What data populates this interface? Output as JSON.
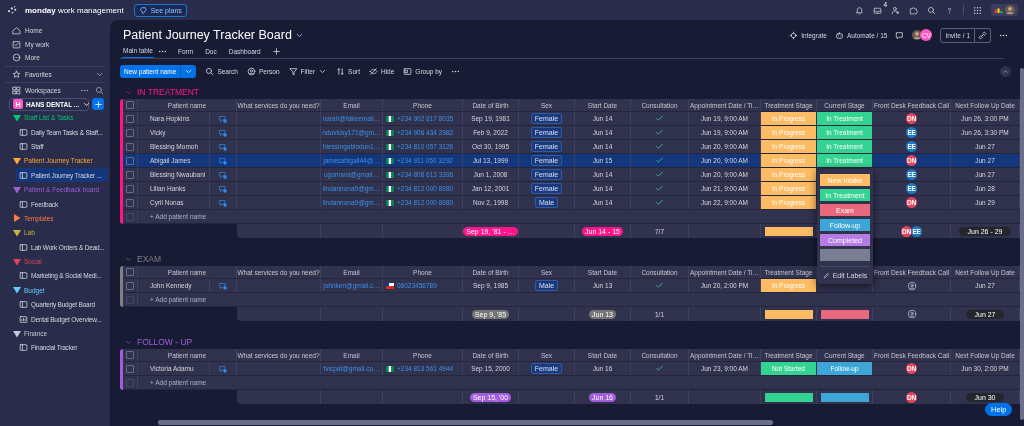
{
  "top_bar": {
    "brand": "**monday** work management",
    "upgrade": "See plans",
    "inbox_count": "4"
  },
  "sidebar": {
    "nav": [
      {
        "label": "Home",
        "kind": "home"
      },
      {
        "label": "My work",
        "kind": "mywork"
      },
      {
        "label": "More",
        "kind": "more"
      }
    ],
    "favorites": "Favorites",
    "workspaces": "Workspaces",
    "workspace": {
      "initial": "H",
      "name": "HANS DENTAL ..."
    },
    "folders": [
      {
        "label": "Staff List & Tasks",
        "color": "#00c875",
        "expanded": true,
        "children": [
          {
            "label": "Daily Team Tasks & Staff...",
            "kind": "board",
            "selected": false
          },
          {
            "label": "Staff",
            "kind": "board",
            "selected": false
          }
        ]
      },
      {
        "label": "Patient Journey Tracker",
        "color": "#fdab3d",
        "expanded": true,
        "children": [
          {
            "label": "Patient Journey Tracker ...",
            "kind": "board",
            "selected": true
          }
        ]
      },
      {
        "label": "Patient & Feedback board",
        "color": "#a25ddc",
        "expanded": true,
        "children": [
          {
            "label": "Feedback",
            "kind": "board",
            "selected": false
          }
        ]
      },
      {
        "label": "Templates",
        "color": "#ff7a45",
        "expanded": false
      },
      {
        "label": "Lab",
        "color": "#cab641",
        "expanded": true,
        "children": [
          {
            "label": "Lab Work Orders & Dead...",
            "kind": "board",
            "selected": false
          }
        ]
      },
      {
        "label": "Social",
        "color": "#e2445c",
        "expanded": true,
        "children": [
          {
            "label": "Marketing & Social Medi...",
            "kind": "board",
            "selected": false
          }
        ]
      },
      {
        "label": "Budget",
        "color": "#66ccff",
        "expanded": true,
        "children": [
          {
            "label": "Quarterly Budget Board",
            "kind": "board",
            "selected": false
          },
          {
            "label": "Dental Budget Overview...",
            "kind": "dashboard",
            "selected": false
          }
        ]
      },
      {
        "label": "Finance",
        "color": "#c5c7d4",
        "expanded": true,
        "children": [
          {
            "label": "Financial Tracker",
            "kind": "board",
            "selected": false
          }
        ]
      }
    ]
  },
  "board": {
    "title": "Patient Journey Tracker Board",
    "integrate": "Integrate",
    "automate": "Automate / 15",
    "member_initials": "CV",
    "invite": "Invite / 1",
    "tabs": [
      {
        "label": "Main table",
        "selected": true
      },
      {
        "label": "Form",
        "selected": false
      },
      {
        "label": "Doc",
        "selected": false
      },
      {
        "label": "Dashboard",
        "selected": false
      }
    ],
    "new_item": "New patient name",
    "tools": [
      {
        "label": "Search",
        "kind": "search"
      },
      {
        "label": "Person",
        "kind": "person"
      },
      {
        "label": "Filter",
        "kind": "filter"
      },
      {
        "label": "Sort",
        "kind": "sort"
      },
      {
        "label": "Hide",
        "kind": "hide"
      },
      {
        "label": "Group by",
        "kind": "group"
      }
    ]
  },
  "groups": [
    {
      "title": "IN TREATMENT",
      "color": "#ff158a",
      "all_checked": false,
      "columns": [
        "Patient name",
        "What services do you need?",
        "Email",
        "Phone",
        "Date of Birth",
        "Sex",
        "Start Date",
        "Consultation",
        "Appointment Date / Ti…",
        "Treatment Stage",
        "Current Stage",
        "Front Desk Feedback Call",
        "Next Follow Up Date"
      ],
      "rows": [
        {
          "checked": false,
          "selected": false,
          "name": "Nara Hopkins",
          "email": "narah@fakeemail…",
          "phone": {
            "kind": "ng",
            "number": "+234 902 817 8035"
          },
          "dob": "Sep 19, 1981",
          "sex": "Female",
          "start": "Jun 14",
          "consultation": true,
          "appointment": "Jun 19, 9:00 AM",
          "treatment": {
            "label": "In Progress",
            "color": "#fdbc64"
          },
          "current": {
            "label": "In Treatment",
            "color": "#33d391"
          },
          "feedback": [
            {
              "kind": "avatar",
              "initials": "DN",
              "color": "#e2445c"
            }
          ],
          "next": "Jun 26, 3:00 PM"
        },
        {
          "checked": false,
          "selected": false,
          "name": "Vicky",
          "email": "nduvicky171@gm…",
          "phone": {
            "kind": "ng",
            "number": "+234 906 434 2982"
          },
          "dob": "Feb 9, 2022",
          "sex": "Female",
          "start": "Jun 14",
          "consultation": true,
          "appointment": "Jun 19, 9:00 AM",
          "treatment": {
            "label": "In Progress",
            "color": "#fdbc64"
          },
          "current": {
            "label": "In Treatment",
            "color": "#33d391"
          },
          "feedback": [
            {
              "kind": "avatar",
              "initials": "EE",
              "color": "#1f76c2"
            }
          ],
          "next": "Jun 26, 3:30 PM"
        },
        {
          "checked": false,
          "selected": false,
          "name": "Blessing Momoh",
          "email": "blessingabiodun1…",
          "phone": {
            "kind": "ng",
            "number": "+234 810 057 3126"
          },
          "dob": "Oct 30, 1995",
          "sex": "Female",
          "start": "Jun 14",
          "consultation": true,
          "appointment": "Jun 20, 9:00 AM",
          "treatment": {
            "label": "In Progress",
            "color": "#fdbc64"
          },
          "current": {
            "label": "In Treatment",
            "color": "#33d391"
          },
          "feedback": [
            {
              "kind": "avatar",
              "initials": "EE",
              "color": "#1f76c2"
            }
          ],
          "next": "Jun 27"
        },
        {
          "checked": false,
          "selected": true,
          "name": "Abigail James",
          "email": "jamesabigail44@…",
          "phone": {
            "kind": "ng",
            "number": "+234 911 050 3292"
          },
          "dob": "Jul 13, 1999",
          "sex": "Female",
          "start": "Jun 15",
          "consultation": true,
          "appointment": "Jun 20, 9:00 AM",
          "treatment": {
            "label": "In Progress",
            "color": "#fdbc64"
          },
          "current": {
            "label": "In Treatment",
            "color": "#33d391"
          },
          "feedback": [
            {
              "kind": "avatar",
              "initials": "DN",
              "color": "#e2445c"
            }
          ],
          "next": "Jun 27"
        },
        {
          "checked": false,
          "selected": false,
          "name": "Blessing Nwaubani",
          "email": "ugonnwa@gmail…",
          "phone": {
            "kind": "ng",
            "number": "+234 808 613 3396"
          },
          "dob": "Jun 1, 2008",
          "sex": "Female",
          "start": "Jun 14",
          "consultation": true,
          "appointment": "Jun 20, 9:00 AM",
          "treatment": {
            "label": "In Progress",
            "color": "#fdbc64"
          },
          "feedback": [
            {
              "kind": "avatar",
              "initials": "EE",
              "color": "#1f76c2"
            }
          ],
          "next": "Jun 27"
        },
        {
          "checked": false,
          "selected": false,
          "name": "Lilian Hanks",
          "email": "lindannona9@gm…",
          "phone": {
            "kind": "ng",
            "number": "+234 812 000 8980"
          },
          "dob": "Jan 12, 2001",
          "sex": "Female",
          "start": "Jun 14",
          "consultation": true,
          "appointment": "Jun 21, 9:00 AM",
          "treatment": {
            "label": "In Progress",
            "color": "#fdbc64"
          },
          "feedback": [
            {
              "kind": "avatar",
              "initials": "EE",
              "color": "#1f76c2"
            }
          ],
          "next": "Jun 28"
        },
        {
          "checked": false,
          "selected": false,
          "name": "Cyril Nonas",
          "email": "lindannona9@gm…",
          "phone": {
            "kind": "ng",
            "number": "+234 812 000 8980"
          },
          "dob": "Nov 2, 1998",
          "sex": "Male",
          "start": "Jun 14",
          "consultation": true,
          "appointment": "Jun 22, 9:00 AM",
          "treatment": {
            "label": "In Progress",
            "color": "#fdbc64"
          },
          "feedback": [
            {
              "kind": "avatar",
              "initials": "DN",
              "color": "#e2445c"
            }
          ],
          "next": "Jun 29"
        }
      ],
      "add_row": {
        "label": "+ Add patient name",
        "checked": false
      },
      "summary": {
        "dob": {
          "label": "Sep 19, '81 - …",
          "color": "#ff158a"
        },
        "start": {
          "label": "Jun 14 - 15",
          "color": "#ff158a"
        },
        "consultation": "7/7",
        "treatment": {
          "color": "#fdbc64"
        },
        "feedback": [
          {
            "kind": "avatar",
            "initials": "DN",
            "color": "#e2445c"
          },
          {
            "kind": "avatar",
            "initials": "EE",
            "color": "#1f76c2"
          }
        ],
        "next": "Jun 26 - 29"
      }
    },
    {
      "title": "EXAM",
      "color": "#808080",
      "all_checked": false,
      "columns": [
        "Patient name",
        "What services do you need?",
        "Email",
        "Phone",
        "Date of Birth",
        "Sex",
        "Start Date",
        "Consultation",
        "Appointment Date / Ti…",
        "Treatment Stage",
        null,
        "Front Desk Feedback Call",
        "Next Follow Up Date"
      ],
      "rows": [
        {
          "checked": false,
          "selected": false,
          "name": "John Kennedy",
          "email": "johnken@gmail.c…",
          "phone": {
            "kind": "cl",
            "number": "08023456789"
          },
          "dob": "Sep 9, 1985",
          "sex": "Male",
          "start": "Jun 13",
          "consultation": true,
          "appointment": "Jun 20, 2:00 PM",
          "treatment": {
            "label": "In Progress",
            "color": "#fdbc64"
          },
          "feedback": [
            {
              "kind": "unassigned"
            }
          ],
          "next": "Jun 27"
        }
      ],
      "add_row": {
        "label": "+ Add patient name",
        "checked": false
      },
      "summary": {
        "dob": {
          "label": "Sep 9, '85",
          "color": "#757575"
        },
        "start": {
          "label": "Jun 13",
          "color": "#757575"
        },
        "consultation": "1/1",
        "treatment": {
          "color": "#fdbc64"
        },
        "current": {
          "color": "#e8697d"
        },
        "feedback": [
          {
            "kind": "unassigned"
          }
        ],
        "next": "Jun 27"
      }
    },
    {
      "title": "FOLLOW - UP",
      "color": "#a25ddc",
      "all_checked": false,
      "columns": [
        "Patient name",
        "What services do you need?",
        "Email",
        "Phone",
        "Date of Birth",
        "Sex",
        "Start Date",
        "Consultation",
        "Appointment Date / Ti…",
        "Treatment Stage",
        "Current Stage",
        "Front Desk Feedback Call",
        "Next Follow Up Date"
      ],
      "rows": [
        {
          "checked": false,
          "selected": false,
          "name": "Victoria Adamu",
          "email": "fvicpat@gmail.co…",
          "phone": {
            "kind": "ng",
            "number": "+234 813 561 4944"
          },
          "dob": "Sep 15, 2000",
          "sex": "Female",
          "start": "Jun 16",
          "consultation": true,
          "appointment": "Jun 23, 9:00 AM",
          "treatment": {
            "label": "Not Started",
            "color": "#33d391"
          },
          "current": {
            "label": "Follow-up",
            "color": "#3ea6d6"
          },
          "feedback": [
            {
              "kind": "avatar",
              "initials": "DN",
              "color": "#e2445c"
            }
          ],
          "next": "Jun 30, 2:00 PM"
        }
      ],
      "add_row": {
        "label": "+ Add patient name",
        "checked": false
      },
      "summary": {
        "dob": {
          "label": "Sep 15, '00",
          "color": "#a25ddc"
        },
        "start": {
          "label": "Jun 16",
          "color": "#a25ddc"
        },
        "consultation": "1/1",
        "treatment": {
          "color": "#33d391"
        },
        "current": {
          "color": "#3ea6d6"
        },
        "feedback": [
          {
            "kind": "avatar",
            "initials": "DN",
            "color": "#e2445c"
          }
        ],
        "next": "Jun 30"
      }
    }
  ],
  "dropdown": {
    "options": [
      {
        "label": "New Intake",
        "color": "#fdbc64"
      },
      {
        "label": "In Treatment",
        "color": "#33d391"
      },
      {
        "label": "Exam",
        "color": "#e8697d"
      },
      {
        "label": "Follow-up",
        "color": "#3ea6d6"
      },
      {
        "label": "Completed",
        "color": "#b57de3"
      },
      {
        "color": "#797e93"
      }
    ],
    "edit": "Edit Labels"
  },
  "help": "Help"
}
